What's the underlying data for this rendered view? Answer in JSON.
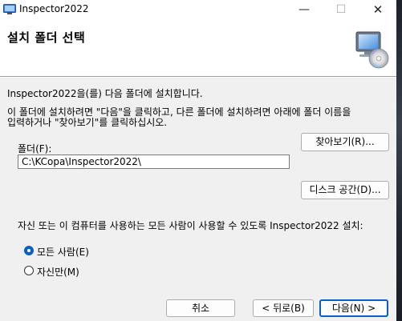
{
  "window": {
    "title": "Inspector2022",
    "minimize_glyph": "—",
    "maximize_glyph": "☐",
    "close_glyph": "✕"
  },
  "banner": {
    "title": "설치 폴더 선택",
    "icon": "computer-disc-icon"
  },
  "content": {
    "intro": "Inspector2022을(를) 다음 폴더에 설치합니다.",
    "instructions_line1": "이 폴더에 설치하려면 \"다음\"을 클릭하고, 다른 폴더에 설치하려면 아래에 폴더 이름을",
    "instructions_line2": "입력하거나 \"찾아보기\"를 클릭하십시오.",
    "folder_label": "폴더(F):",
    "folder_value": "C:\\KCopa\\Inspector2022\\",
    "browse_button": "찾아보기(R)...",
    "disk_space_button": "디스크 공간(D)...",
    "install_for_prompt": "자신 또는 이 컴퓨터를 사용하는 모든 사람이 사용할 수 있도록 Inspector2022 설치:",
    "radio_options": [
      {
        "label": "모든 사람(E)",
        "selected": true
      },
      {
        "label": "자신만(M)",
        "selected": false
      }
    ]
  },
  "footer": {
    "cancel_button": "취소",
    "back_button": "< 뒤로(B)",
    "next_button": "다음(N) >"
  },
  "colors": {
    "accent": "#0a5fc7",
    "window_bg": "#f0f0f0",
    "banner_bg": "#ffffff"
  }
}
